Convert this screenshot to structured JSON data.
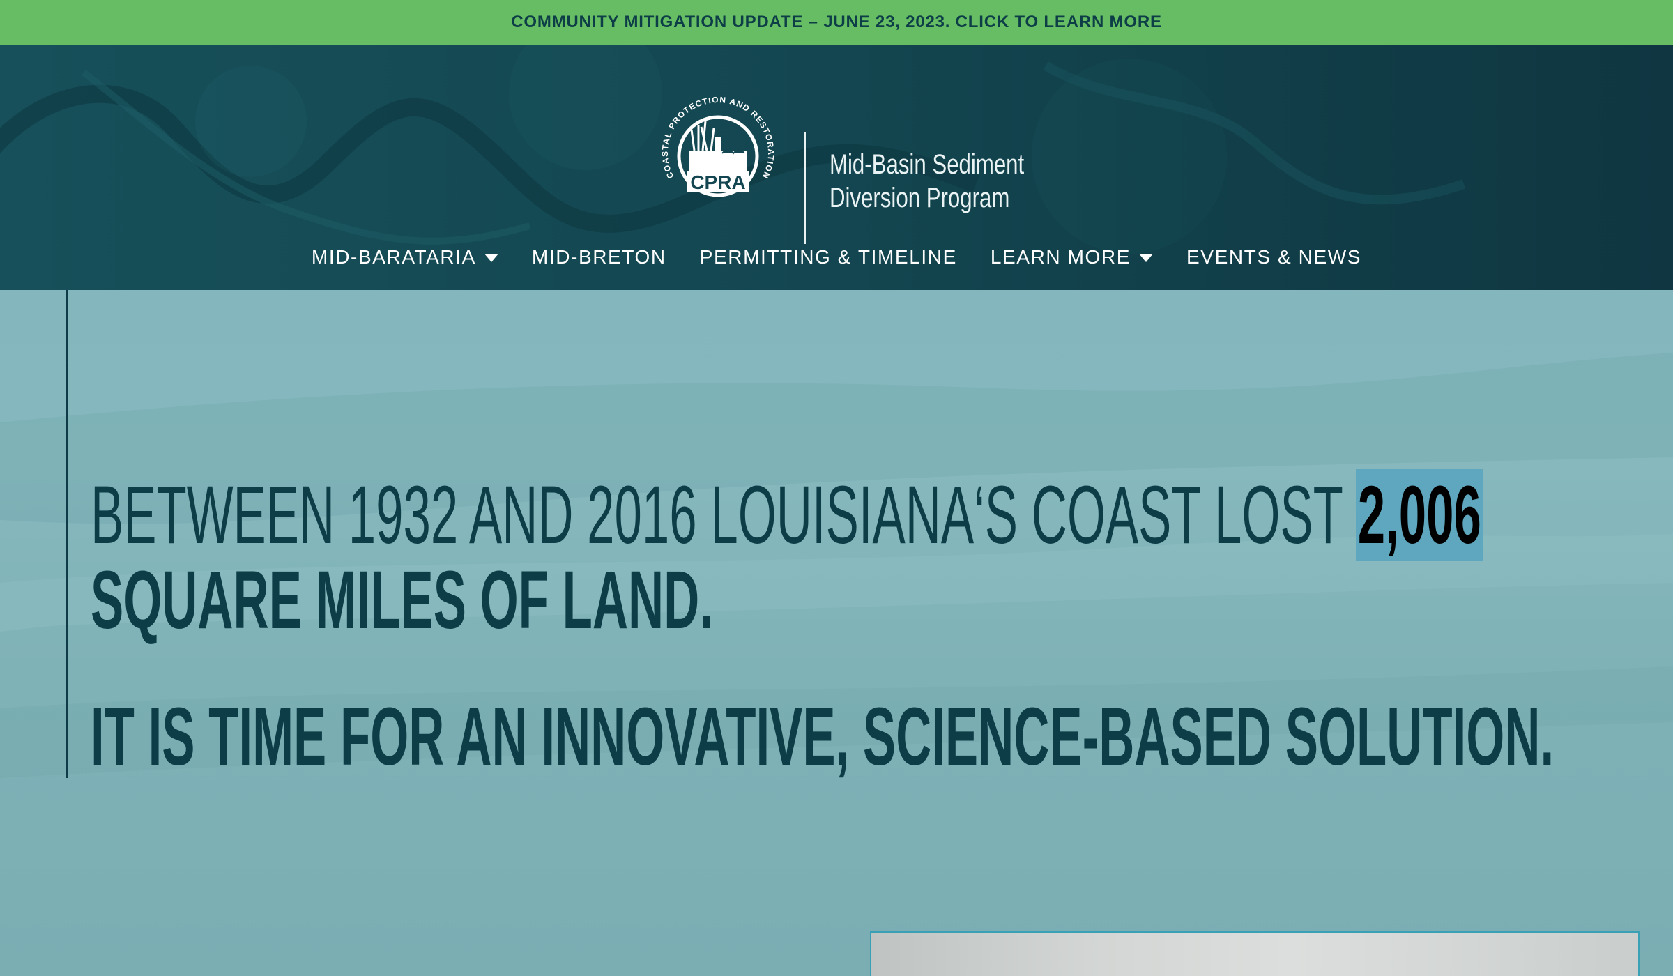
{
  "banner": {
    "text": "COMMUNITY MITIGATION UPDATE – JUNE 23, 2023. CLICK TO LEARN MORE"
  },
  "header": {
    "logo": {
      "seal_ring_text": "COASTAL PROTECTION AND RESTORATION AUTHORITY",
      "seal_abbrev": "CPRA",
      "program_line1": "Mid-Basin Sediment",
      "program_line2": "Diversion Program"
    },
    "nav": [
      {
        "label": "MID-BARATARIA",
        "has_dropdown": true
      },
      {
        "label": "MID-BRETON",
        "has_dropdown": false
      },
      {
        "label": "PERMITTING & TIMELINE",
        "has_dropdown": false
      },
      {
        "label": "LEARN MORE",
        "has_dropdown": true
      },
      {
        "label": "EVENTS & NEWS",
        "has_dropdown": false
      }
    ]
  },
  "hero": {
    "headline_light": "BETWEEN 1932 AND 2016 LOUISIANA‘S COAST LOST ",
    "headline_highlight": "2,006",
    "headline_bold": "SQUARE MILES OF LAND.",
    "tagline": "IT IS TIME FOR AN INNOVATIVE, SCIENCE-BASED SOLUTION."
  },
  "colors": {
    "banner_bg": "#66bd63",
    "banner_text": "#0d3d47",
    "header_bg": "#0f3641",
    "hero_bg": "#7fb2b8",
    "headline_text": "#0d3d47",
    "highlight_bg": "#5ea7bf"
  },
  "icons": {
    "dropdown": "caret-down-icon",
    "seal": "cpra-seal-icon"
  }
}
